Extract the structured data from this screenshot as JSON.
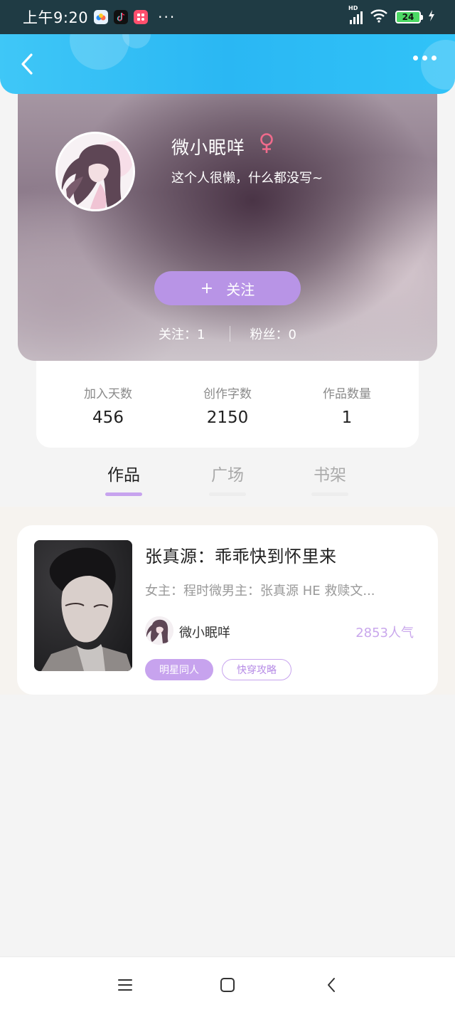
{
  "status_bar": {
    "time": "上午9:20",
    "more": "···",
    "battery": "24",
    "network_label": "HD",
    "app_icons": [
      "baidu-netdisk-icon",
      "douyin-icon",
      "app-icon"
    ]
  },
  "nav": {
    "back_icon": "chevron-left-icon",
    "more_icon": "more-dots-icon"
  },
  "profile": {
    "nickname": "微小眠咩",
    "gender_symbol": "♀",
    "gender_color": "#f06b8c",
    "bio": "这个人很懒，什么都没写~",
    "follow_plus": "+",
    "follow_label": "关注",
    "following": "关注：1",
    "fans": "粉丝：0"
  },
  "stats": [
    {
      "label": "加入天数",
      "value": "456"
    },
    {
      "label": "创作字数",
      "value": "2150"
    },
    {
      "label": "作品数量",
      "value": "1"
    }
  ],
  "tabs": [
    {
      "label": "作品",
      "active": true
    },
    {
      "label": "广场",
      "active": false
    },
    {
      "label": "书架",
      "active": false
    }
  ],
  "books": [
    {
      "title": "张真源：乖乖快到怀里来",
      "description": "女主：程时微男主：张真源  HE 救赎文...",
      "author": "微小眠咩",
      "popularity": "2853人气",
      "tags": [
        "明星同人",
        "快穿攻略"
      ]
    }
  ],
  "colors": {
    "accent": "#c7a3ee",
    "nav_blue": "#2ab7f3",
    "status_bar": "#1f3b44"
  },
  "system_nav": {
    "menu_icon": "menu-icon",
    "home_icon": "home-square-icon",
    "back_icon": "back-triangle-icon"
  }
}
